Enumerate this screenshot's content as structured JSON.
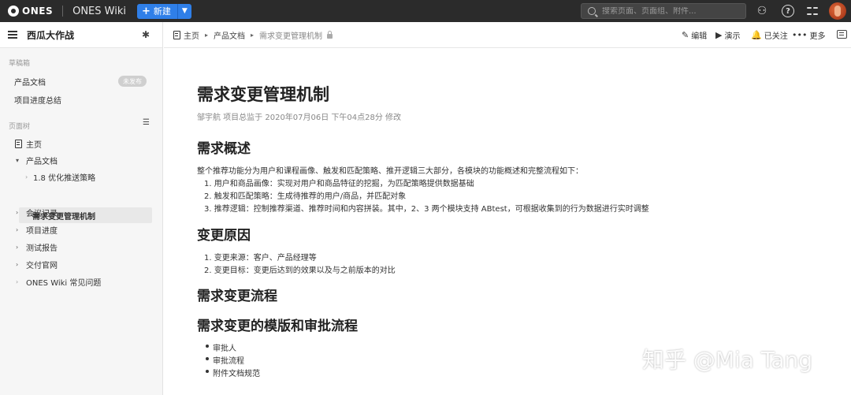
{
  "topbar": {
    "brand": "ONES",
    "app_title": "ONES Wiki",
    "new_button": "新建",
    "search_placeholder": "搜索页面、页面组、附件..."
  },
  "sidebar": {
    "space_name": "西瓜大作战",
    "drafts_section": "草稿箱",
    "drafts": [
      {
        "label": "产品文档",
        "badge": "未发布"
      },
      {
        "label": "项目进度总结"
      }
    ],
    "tree_section": "页面树",
    "tree": {
      "home": "主页",
      "product_docs": "产品文档",
      "child_1": "1.8 优化推送策略",
      "child_2": "需求变更管理机制",
      "meetings": "会议记录",
      "progress": "项目进度",
      "test_reports": "测试报告",
      "delivery": "交付官网",
      "faq": "ONES Wiki 常见问题"
    }
  },
  "breadcrumb": {
    "home": "主页",
    "parent": "产品文档",
    "current": "需求变更管理机制"
  },
  "actions": {
    "edit": "编辑",
    "present": "演示",
    "follow": "已关注",
    "more": "更多"
  },
  "document": {
    "title": "需求变更管理机制",
    "meta": "邹宇航 项目总监于 2020年07月06日 下午04点28分 修改",
    "h_overview": "需求概述",
    "overview_intro": "整个推荐功能分为用户和课程画像、触发和匹配策略、推开逻辑三大部分，各模块的功能概述和完整流程如下：",
    "overview_items": [
      "1. 用户和商品画像：实现对用户和商品特征的挖掘，为匹配策略提供数据基础",
      "2. 触发和匹配策略：生成待推荐的用户/商品，并匹配对象",
      "3. 推荐逻辑：控制推荐渠道、推荐时间和内容拼装。其中，2、3 两个模块支持 ABtest，可根据收集到的行为数据进行实时调整"
    ],
    "h_reason": "变更原因",
    "reason_items": [
      "1. 变更来源：客户、产品经理等",
      "2. 变更目标：变更后达到的效果以及与之前版本的对比"
    ],
    "h_flow": "需求变更流程",
    "h_template": "需求变更的模版和审批流程",
    "template_items": [
      "审批人",
      "审批流程",
      "附件文档规范"
    ]
  },
  "watermark": "知乎 @Mia Tang"
}
